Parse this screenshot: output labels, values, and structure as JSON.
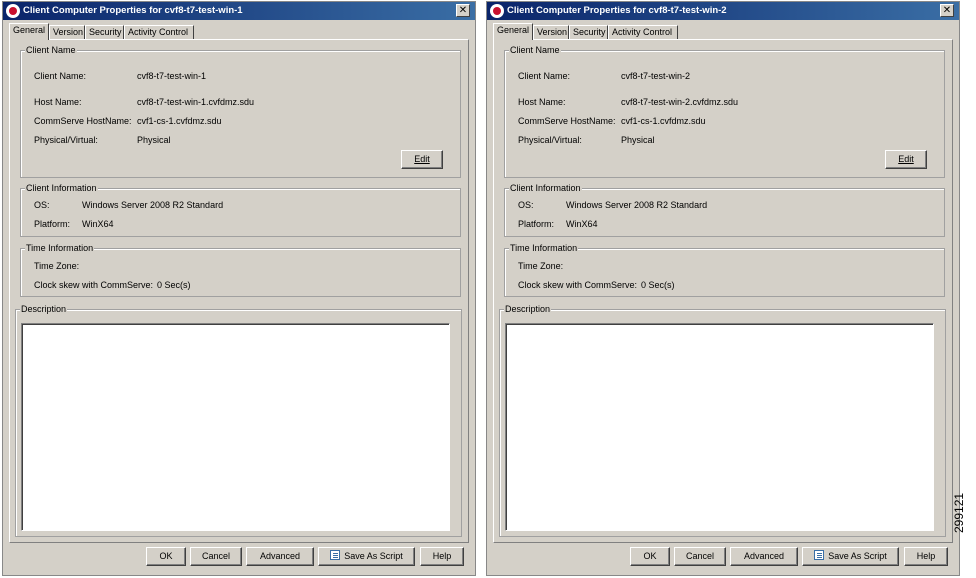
{
  "dialogs": [
    {
      "title": "Client Computer Properties for cvf8-t7-test-win-1",
      "tabs": [
        "General",
        "Version",
        "Security",
        "Activity Control"
      ],
      "client_name_group": {
        "title": "Client Name",
        "client_name_label": "Client Name:",
        "client_name_value": "cvf8-t7-test-win-1",
        "host_name_label": "Host Name:",
        "host_name_value": "cvf8-t7-test-win-1.cvfdmz.sdu",
        "commserve_label": "CommServe HostName:",
        "commserve_value": "cvf1-cs-1.cvfdmz.sdu",
        "physical_label": "Physical/Virtual:",
        "physical_value": "Physical",
        "edit_label": "Edit"
      },
      "client_info_group": {
        "title": "Client Information",
        "os_label": "OS:",
        "os_value": "Windows Server 2008 R2 Standard",
        "platform_label": "Platform:",
        "platform_value": "WinX64"
      },
      "time_group": {
        "title": "Time Information",
        "timezone_label": "Time Zone:",
        "timezone_value": "",
        "skew_label": "Clock skew with CommServe:",
        "skew_value": "0 Sec(s)"
      },
      "description_group": {
        "title": "Description",
        "text": ""
      },
      "buttons": {
        "ok": "OK",
        "cancel": "Cancel",
        "advanced": "Advanced",
        "save_script": "Save As Script",
        "help": "Help"
      }
    },
    {
      "title": "Client Computer Properties for cvf8-t7-test-win-2",
      "tabs": [
        "General",
        "Version",
        "Security",
        "Activity Control"
      ],
      "client_name_group": {
        "title": "Client Name",
        "client_name_label": "Client Name:",
        "client_name_value": "cvf8-t7-test-win-2",
        "host_name_label": "Host Name:",
        "host_name_value": "cvf8-t7-test-win-2.cvfdmz.sdu",
        "commserve_label": "CommServe HostName:",
        "commserve_value": "cvf1-cs-1.cvfdmz.sdu",
        "physical_label": "Physical/Virtual:",
        "physical_value": "Physical",
        "edit_label": "Edit"
      },
      "client_info_group": {
        "title": "Client Information",
        "os_label": "OS:",
        "os_value": "Windows Server 2008 R2 Standard",
        "platform_label": "Platform:",
        "platform_value": "WinX64"
      },
      "time_group": {
        "title": "Time Information",
        "timezone_label": "Time Zone:",
        "timezone_value": "",
        "skew_label": "Clock skew with CommServe:",
        "skew_value": "0 Sec(s)"
      },
      "description_group": {
        "title": "Description",
        "text": ""
      },
      "buttons": {
        "ok": "OK",
        "cancel": "Cancel",
        "advanced": "Advanced",
        "save_script": "Save As Script",
        "help": "Help"
      }
    }
  ],
  "figure_number": "299121"
}
